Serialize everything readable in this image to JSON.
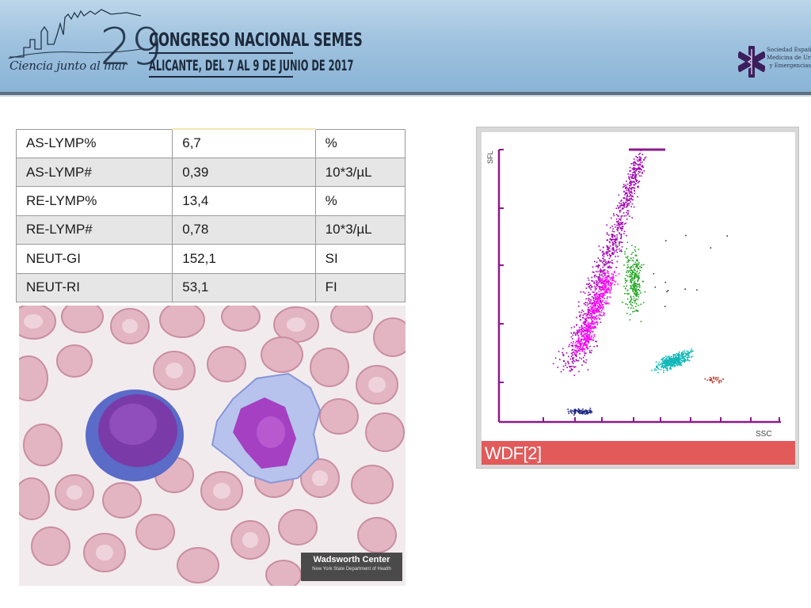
{
  "header": {
    "tagline": "Ciencia junto al mar",
    "edition": "29",
    "congress_title": "CONGRESO NACIONAL SEMES",
    "venue_dates": "ALICANTE, DEL 7 AL 9 DE JUNIO DE 2017",
    "society_name_lines": [
      "Sociedad Española de",
      "Medicina de Urgencias",
      "y Emergencias"
    ]
  },
  "results_table": {
    "rows": [
      {
        "param": "AS-LYMP%",
        "value": "6,7",
        "unit": "%"
      },
      {
        "param": "AS-LYMP#",
        "value": "0,39",
        "unit": "10*3/µL"
      },
      {
        "param": "RE-LYMP%",
        "value": "13,4",
        "unit": "%"
      },
      {
        "param": "RE-LYMP#",
        "value": "0,78",
        "unit": "10*3/µL"
      },
      {
        "param": "NEUT-GI",
        "value": "152,1",
        "unit": "SI"
      },
      {
        "param": "NEUT-RI",
        "value": "53,1",
        "unit": "FI"
      }
    ]
  },
  "smear_image": {
    "watermark_title": "Wadsworth Center",
    "watermark_subtitle": "New York State Department of Health"
  },
  "scattergram": {
    "panel_label": "WDF[2]",
    "y_axis_label": "SFL",
    "x_axis_label": "SSC",
    "colors": {
      "axis": "#8b1a8b",
      "lymphocytes": "#a000b0",
      "lymph_core": "#ff00ff",
      "monocytes": "#1fa31f",
      "neutrophils": "#10b8b8",
      "eosinophils": "#c0392b",
      "debris": "#1a237e",
      "panel_bar": "#e25a5a"
    }
  }
}
